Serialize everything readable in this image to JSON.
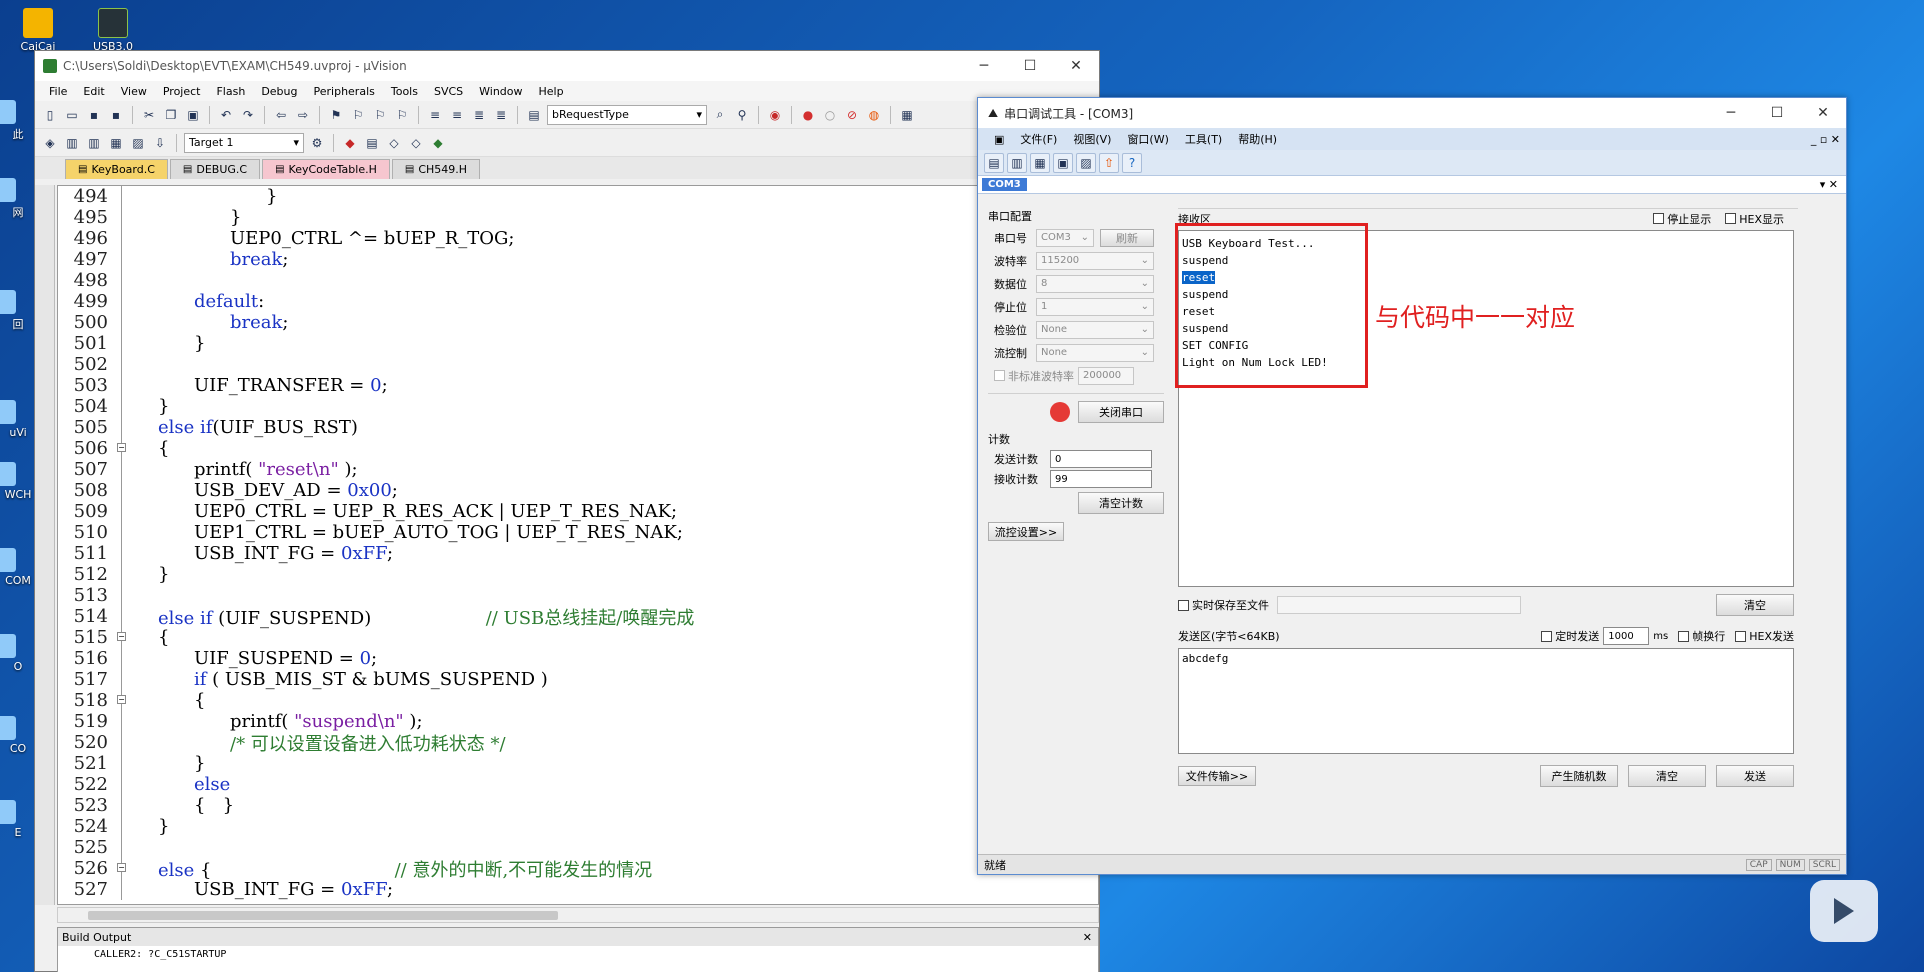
{
  "desktop": {
    "icons": [
      {
        "label": "CaiCai"
      },
      {
        "label": "USB3.0"
      }
    ],
    "side_labels": [
      "此",
      "网",
      "回",
      "uVi",
      "WCH",
      "COM",
      "O",
      "CO",
      "E"
    ]
  },
  "uvision": {
    "title": "C:\\Users\\Soldi\\Desktop\\EVT\\EXAM\\CH549.uvproj - µVision",
    "menu": [
      "File",
      "Edit",
      "View",
      "Project",
      "Flash",
      "Debug",
      "Peripherals",
      "Tools",
      "SVCS",
      "Window",
      "Help"
    ],
    "find_combo": "bRequestType",
    "target_combo": "Target 1",
    "tabs": [
      "KeyBoard.C",
      "DEBUG.C",
      "KeyCodeTable.H",
      "CH549.H"
    ],
    "active_tab_color": "#f5d36a",
    "code_lines": [
      {
        "no": "494",
        "fold": "bar",
        "indent": 3,
        "parts": [
          {
            "t": "}"
          }
        ]
      },
      {
        "no": "495",
        "fold": "bar",
        "indent": 2,
        "parts": [
          {
            "t": "}"
          }
        ]
      },
      {
        "no": "496",
        "fold": "bar",
        "indent": 2,
        "parts": [
          {
            "t": "UEP0_CTRL ^= bUEP_R_TOG;"
          }
        ]
      },
      {
        "no": "497",
        "fold": "bar",
        "indent": 2,
        "parts": [
          {
            "t": "break",
            "c": "kw"
          },
          {
            "t": ";"
          }
        ]
      },
      {
        "no": "498",
        "fold": "bar",
        "indent": 0,
        "parts": []
      },
      {
        "no": "499",
        "fold": "bar",
        "indent": 1,
        "parts": [
          {
            "t": "default",
            "c": "kw"
          },
          {
            "t": ":"
          }
        ]
      },
      {
        "no": "500",
        "fold": "bar",
        "indent": 2,
        "parts": [
          {
            "t": "break",
            "c": "kw"
          },
          {
            "t": ";"
          }
        ]
      },
      {
        "no": "501",
        "fold": "bar",
        "indent": 1,
        "parts": [
          {
            "t": "}"
          }
        ]
      },
      {
        "no": "502",
        "fold": "bar",
        "indent": 0,
        "parts": []
      },
      {
        "no": "503",
        "fold": "bar",
        "indent": 1,
        "parts": [
          {
            "t": "UIF_TRANSFER = "
          },
          {
            "t": "0",
            "c": "num"
          },
          {
            "t": ";"
          }
        ]
      },
      {
        "no": "504",
        "fold": "bar",
        "indent": 0,
        "parts": [
          {
            "t": "}"
          }
        ]
      },
      {
        "no": "505",
        "fold": "bar",
        "indent": 0,
        "parts": [
          {
            "t": "else if",
            "c": "kw"
          },
          {
            "t": "(UIF_BUS_RST)"
          }
        ]
      },
      {
        "no": "506",
        "fold": "box",
        "indent": 0,
        "parts": [
          {
            "t": "{"
          }
        ]
      },
      {
        "no": "507",
        "fold": "bar",
        "indent": 1,
        "parts": [
          {
            "t": "printf( "
          },
          {
            "t": "\"reset\\n\"",
            "c": "str"
          },
          {
            "t": " );"
          }
        ]
      },
      {
        "no": "508",
        "fold": "bar",
        "indent": 1,
        "parts": [
          {
            "t": "USB_DEV_AD = "
          },
          {
            "t": "0x00",
            "c": "num"
          },
          {
            "t": ";"
          }
        ]
      },
      {
        "no": "509",
        "fold": "bar",
        "indent": 1,
        "parts": [
          {
            "t": "UEP0_CTRL = UEP_R_RES_ACK | UEP_T_RES_NAK;"
          }
        ]
      },
      {
        "no": "510",
        "fold": "bar",
        "indent": 1,
        "parts": [
          {
            "t": "UEP1_CTRL = bUEP_AUTO_TOG | UEP_T_RES_NAK;"
          }
        ]
      },
      {
        "no": "511",
        "fold": "bar",
        "indent": 1,
        "parts": [
          {
            "t": "USB_INT_FG = "
          },
          {
            "t": "0xFF",
            "c": "num"
          },
          {
            "t": ";"
          }
        ]
      },
      {
        "no": "512",
        "fold": "bar",
        "indent": 0,
        "parts": [
          {
            "t": "}"
          }
        ]
      },
      {
        "no": "513",
        "fold": "bar",
        "indent": 0,
        "parts": []
      },
      {
        "no": "514",
        "fold": "bar",
        "indent": 0,
        "parts": [
          {
            "t": "else if",
            "c": "kw"
          },
          {
            "t": " (UIF_SUSPEND)                    "
          },
          {
            "t": "// USB总线挂起/唤醒完成",
            "c": "cmt"
          }
        ]
      },
      {
        "no": "515",
        "fold": "box",
        "indent": 0,
        "parts": [
          {
            "t": "{"
          }
        ]
      },
      {
        "no": "516",
        "fold": "bar",
        "indent": 1,
        "parts": [
          {
            "t": "UIF_SUSPEND = "
          },
          {
            "t": "0",
            "c": "num"
          },
          {
            "t": ";"
          }
        ]
      },
      {
        "no": "517",
        "fold": "bar",
        "indent": 1,
        "parts": [
          {
            "t": "if",
            "c": "kw"
          },
          {
            "t": " ( USB_MIS_ST & bUMS_SUSPEND )"
          }
        ]
      },
      {
        "no": "518",
        "fold": "box",
        "indent": 1,
        "parts": [
          {
            "t": "{"
          }
        ]
      },
      {
        "no": "519",
        "fold": "bar",
        "indent": 2,
        "parts": [
          {
            "t": "printf( "
          },
          {
            "t": "\"suspend\\n\"",
            "c": "str"
          },
          {
            "t": " );"
          }
        ]
      },
      {
        "no": "520",
        "fold": "bar",
        "indent": 2,
        "parts": [
          {
            "t": "/* 可以设置设备进入低功耗状态 */",
            "c": "cmt"
          }
        ]
      },
      {
        "no": "521",
        "fold": "bar",
        "indent": 1,
        "parts": [
          {
            "t": "}"
          }
        ]
      },
      {
        "no": "522",
        "fold": "bar",
        "indent": 1,
        "parts": [
          {
            "t": "else",
            "c": "kw"
          }
        ]
      },
      {
        "no": "523",
        "fold": "bar",
        "indent": 1,
        "parts": [
          {
            "t": "{   }"
          }
        ]
      },
      {
        "no": "524",
        "fold": "bar",
        "indent": 0,
        "parts": [
          {
            "t": "}"
          }
        ]
      },
      {
        "no": "525",
        "fold": "bar",
        "indent": 0,
        "parts": []
      },
      {
        "no": "526",
        "fold": "box",
        "indent": 0,
        "parts": [
          {
            "t": "else",
            "c": "kw"
          },
          {
            "t": " {                                "
          },
          {
            "t": "// 意外的中断,不可能发生的情况",
            "c": "cmt"
          }
        ]
      },
      {
        "no": "527",
        "fold": "bar",
        "indent": 1,
        "parts": [
          {
            "t": "USB_INT_FG = "
          },
          {
            "t": "0xFF",
            "c": "num"
          },
          {
            "t": ";"
          }
        ]
      }
    ],
    "build_output": {
      "title": "Build Output",
      "line": "CALLER2: ?C_C51STARTUP"
    }
  },
  "serial_tool": {
    "title": "串口调试工具 - [COM3]",
    "menu": [
      "文件(F)",
      "视图(V)",
      "窗口(W)",
      "工具(T)",
      "帮助(H)"
    ],
    "doc_tab": "COM3",
    "config": {
      "group_title": "串口配置",
      "rows": [
        {
          "label": "串口号",
          "value": "COM3",
          "extra": "刷新"
        },
        {
          "label": "波特率",
          "value": "115200"
        },
        {
          "label": "数据位",
          "value": "8"
        },
        {
          "label": "停止位",
          "value": "1"
        },
        {
          "label": "检验位",
          "value": "None"
        },
        {
          "label": "流控制",
          "value": "None"
        }
      ],
      "nonstandard_label": "非标准波特率",
      "nonstandard_value": "200000",
      "close_port": "关闭串口",
      "port_status_color": "#e53935"
    },
    "counter": {
      "title": "计数",
      "send_label": "发送计数",
      "send_value": "0",
      "recv_label": "接收计数",
      "recv_value": "99",
      "clear": "清空计数"
    },
    "flow_settings": "流控设置>>",
    "receive": {
      "title": "接收区",
      "stop_display": "停止显示",
      "hex_display": "HEX显示",
      "lines": [
        "USB Keyboard Test...",
        "suspend",
        "reset",
        "suspend",
        "reset",
        "suspend",
        "SET CONFIG",
        "Light on Num Lock LED!"
      ],
      "highlighted_index": 2,
      "save_to_file": "实时保存至文件",
      "clear": "清空"
    },
    "send": {
      "title": "发送区(字节<64KB)",
      "timed_send": "定时发送",
      "interval": "1000",
      "unit": "ms",
      "newline": "帧换行",
      "hex_send": "HEX发送",
      "content": "abcdefg",
      "file_transfer": "文件传输>>",
      "random": "产生随机数",
      "clear": "清空",
      "send": "发送"
    },
    "status": {
      "text": "就绪",
      "indicators": [
        "CAP",
        "NUM",
        "SCRL"
      ]
    }
  },
  "annotation": {
    "text": "与代码中一一对应",
    "color": "#e02020"
  }
}
